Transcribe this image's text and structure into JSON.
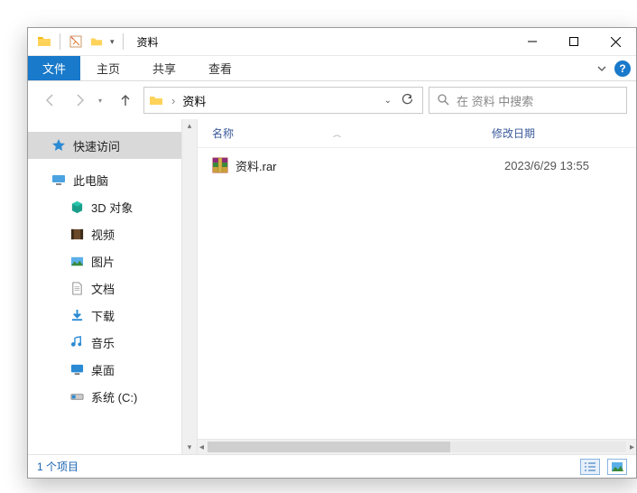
{
  "title": "资料",
  "ribbon": {
    "file": "文件",
    "tabs": [
      "主页",
      "共享",
      "查看"
    ]
  },
  "breadcrumb": {
    "current": "资料"
  },
  "search": {
    "placeholder": "在 资料 中搜索"
  },
  "sidebar": {
    "quick_access": "快速访问",
    "this_pc": "此电脑",
    "items": [
      {
        "label": "3D 对象",
        "icon": "cube-icon"
      },
      {
        "label": "视频",
        "icon": "video-icon"
      },
      {
        "label": "图片",
        "icon": "picture-icon"
      },
      {
        "label": "文档",
        "icon": "document-icon"
      },
      {
        "label": "下载",
        "icon": "download-icon"
      },
      {
        "label": "音乐",
        "icon": "music-icon"
      },
      {
        "label": "桌面",
        "icon": "desktop-icon"
      },
      {
        "label": "系统 (C:)",
        "icon": "drive-icon"
      }
    ]
  },
  "columns": {
    "name": "名称",
    "date": "修改日期"
  },
  "files": [
    {
      "name": "资料.rar",
      "date": "2023/6/29 13:55"
    }
  ],
  "status": {
    "count": "1 个项目"
  }
}
